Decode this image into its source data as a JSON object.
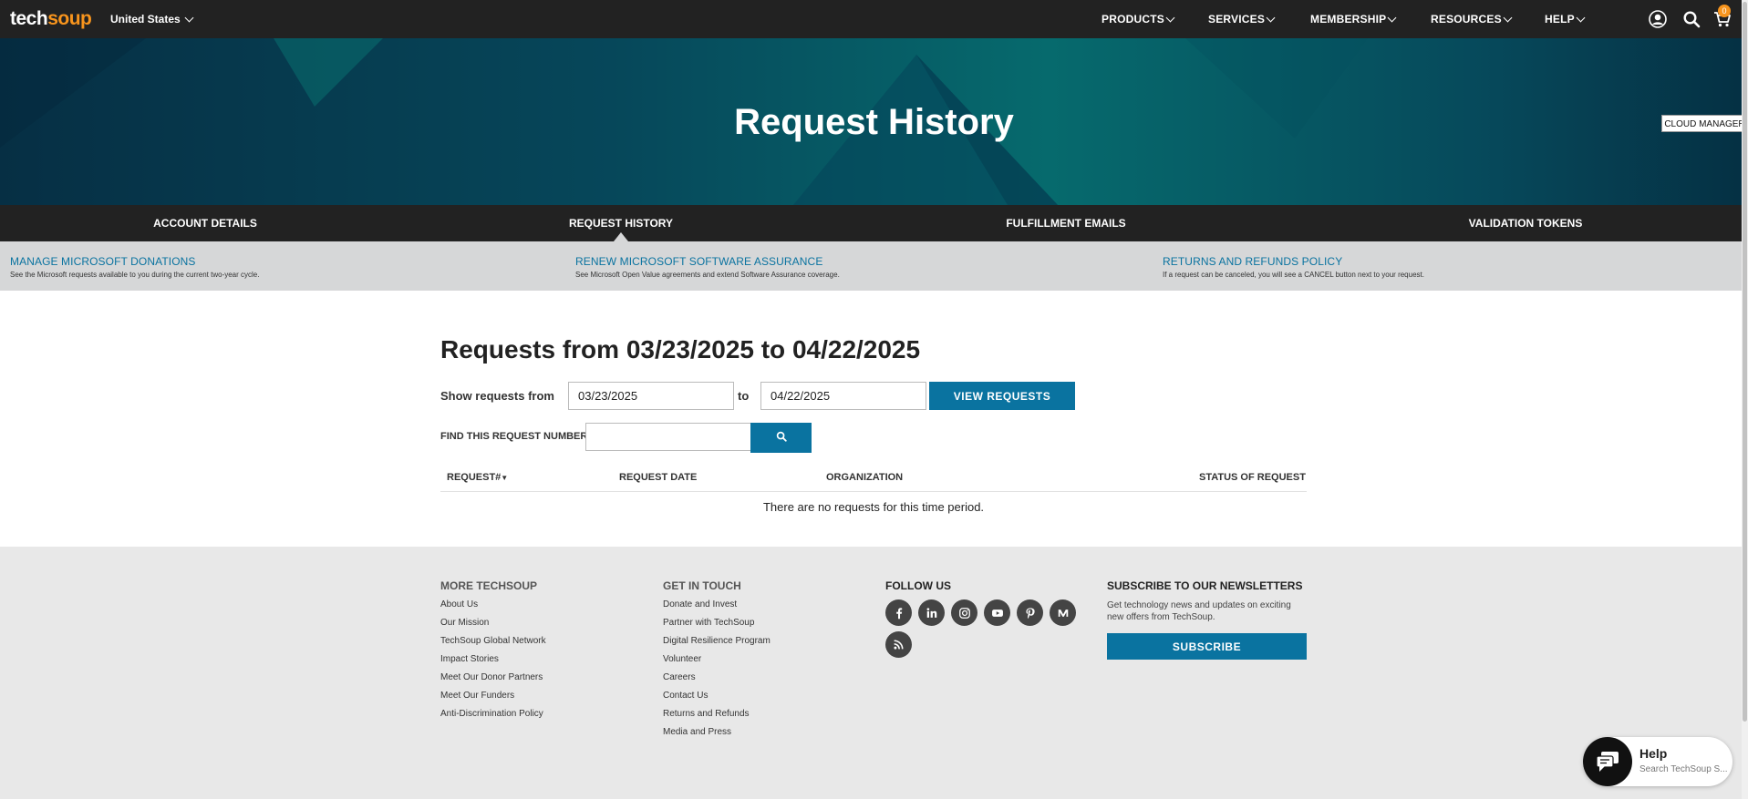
{
  "topnav": {
    "logo_part1": "tech",
    "logo_part2": "soup",
    "country": "United States",
    "menu": [
      "PRODUCTS",
      "SERVICES",
      "MEMBERSHIP",
      "RESOURCES",
      "HELP"
    ],
    "cart_count": "0",
    "icons": [
      "user-icon",
      "search-icon",
      "cart-icon"
    ]
  },
  "hero": {
    "title": "Request History",
    "cloud_manager": "CLOUD MANAGER"
  },
  "tabs": [
    "ACCOUNT DETAILS",
    "REQUEST HISTORY",
    "FULFILLMENT EMAILS",
    "VALIDATION TOKENS"
  ],
  "active_tab": "REQUEST HISTORY",
  "info": [
    {
      "link": "MANAGE MICROSOFT DONATIONS",
      "desc": "See the Microsoft requests available to you during the current two-year cycle."
    },
    {
      "link": "RENEW MICROSOFT SOFTWARE ASSURANCE",
      "desc": "See Microsoft Open Value agreements and extend Software Assurance coverage."
    },
    {
      "link": "RETURNS AND REFUNDS POLICY",
      "desc": "If a request can be canceled, you will see a CANCEL button next to your request."
    }
  ],
  "main": {
    "heading": "Requests from 03/23/2025 to 04/22/2025",
    "show_label": "Show requests from",
    "from_date": "03/23/2025",
    "to_label": "to",
    "to_date": "04/22/2025",
    "view_button": "VIEW REQUESTS",
    "find_label": "FIND THIS REQUEST NUMBER",
    "find_value": "",
    "columns": [
      "REQUEST#",
      "REQUEST DATE",
      "ORGANIZATION",
      "STATUS OF REQUEST"
    ],
    "empty_message": "There are no requests for this time period."
  },
  "footer": {
    "more": {
      "title": "MORE TECHSOUP",
      "links": [
        "About Us",
        "Our Mission",
        "TechSoup Global Network",
        "Impact Stories",
        "Meet Our Donor Partners",
        "Meet Our Funders",
        "Anti-Discrimination Policy"
      ]
    },
    "contact": {
      "title": "GET IN TOUCH",
      "links": [
        "Donate and Invest",
        "Partner with TechSoup",
        "Digital Resilience Program",
        "Volunteer",
        "Careers",
        "Contact Us",
        "Returns and Refunds",
        "Media and Press"
      ]
    },
    "follow": {
      "title": "FOLLOW US",
      "icons": [
        "facebook-icon",
        "linkedin-icon",
        "instagram-icon",
        "youtube-icon",
        "pinterest-icon",
        "medium-icon",
        "rss-icon"
      ]
    },
    "newsletter": {
      "title": "SUBSCRIBE TO OUR NEWSLETTERS",
      "desc": "Get technology news and updates on exciting new offers from TechSoup.",
      "button": "SUBSCRIBE"
    }
  },
  "help_widget": {
    "title": "Help",
    "subtitle": "Search TechSoup S..."
  },
  "colors": {
    "nav_bg": "#222222",
    "accent_blue": "#0a73a0",
    "logo_orange": "#f7941d",
    "info_bg": "#d6d7d8",
    "footer_bg": "#e8e8e8"
  }
}
